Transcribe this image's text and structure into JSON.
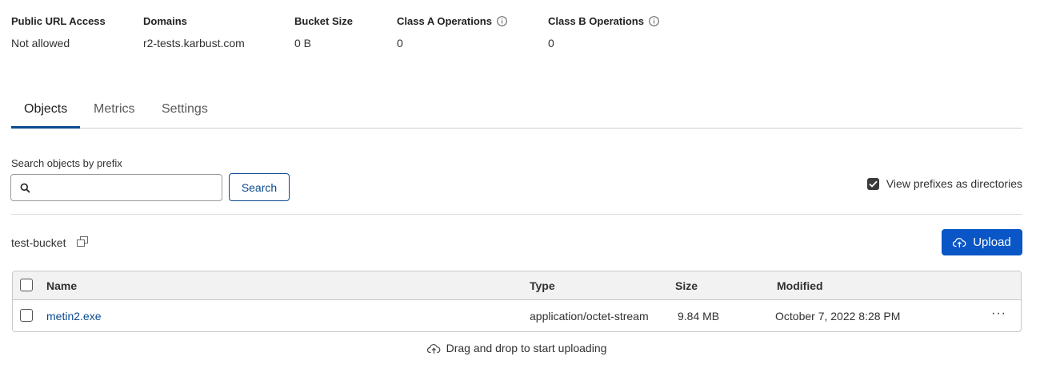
{
  "stats": [
    {
      "label": "Public URL Access",
      "value": "Not allowed",
      "info": false
    },
    {
      "label": "Domains",
      "value": "r2-tests.karbust.com",
      "info": false
    },
    {
      "label": "Bucket Size",
      "value": "0 B",
      "info": false
    },
    {
      "label": "Class A Operations",
      "value": "0",
      "info": true
    },
    {
      "label": "Class B Operations",
      "value": "0",
      "info": true
    }
  ],
  "tabs": [
    {
      "label": "Objects",
      "active": true
    },
    {
      "label": "Metrics",
      "active": false
    },
    {
      "label": "Settings",
      "active": false
    }
  ],
  "search": {
    "label": "Search objects by prefix",
    "placeholder": "",
    "value": "",
    "button_label": "Search"
  },
  "view_prefixes": {
    "label": "View prefixes as directories",
    "checked": true
  },
  "bucket": {
    "name": "test-bucket"
  },
  "upload": {
    "label": "Upload"
  },
  "table": {
    "headers": {
      "name": "Name",
      "type": "Type",
      "size": "Size",
      "modified": "Modified"
    },
    "rows": [
      {
        "name": "metin2.exe",
        "type": "application/octet-stream",
        "size": "9.84 MB",
        "modified": "October 7, 2022 8:28 PM",
        "more": "···"
      }
    ]
  },
  "dropzone": {
    "label": "Drag and drop to start uploading"
  },
  "colors": {
    "accent": "#0a4a8f",
    "primary_button": "#0a56c6"
  }
}
